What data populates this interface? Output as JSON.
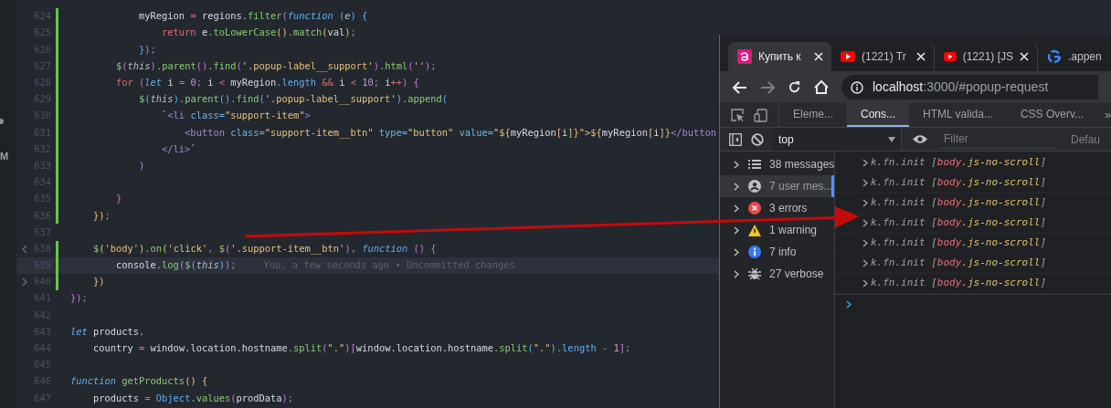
{
  "editor": {
    "side_letter": "M",
    "lines": [
      {
        "number": "624",
        "changed": true,
        "current": false,
        "tokens": [
          {
            "kind": "var",
            "text": "            myRegion "
          },
          {
            "kind": "op",
            "text": "="
          },
          {
            "kind": "var",
            "text": " regions"
          },
          {
            "kind": "fn",
            "text": ".filter"
          },
          {
            "kind": "b2",
            "text": "("
          },
          {
            "kind": "it",
            "text": "function "
          },
          {
            "kind": "b3",
            "text": "("
          },
          {
            "kind": "self",
            "text": "e"
          },
          {
            "kind": "b3",
            "text": ") {"
          }
        ]
      },
      {
        "number": "625",
        "changed": true,
        "current": false,
        "tokens": [
          {
            "kind": "kw",
            "text": "                return"
          },
          {
            "kind": "var",
            "text": " e"
          },
          {
            "kind": "fn",
            "text": ".toLowerCase"
          },
          {
            "kind": "b1",
            "text": "()"
          },
          {
            "kind": "fn",
            "text": ".match"
          },
          {
            "kind": "b1",
            "text": "("
          },
          {
            "kind": "var",
            "text": "val"
          },
          {
            "kind": "b1",
            "text": ")"
          },
          {
            "kind": "p",
            "text": ";"
          }
        ]
      },
      {
        "number": "626",
        "changed": true,
        "current": false,
        "tokens": [
          {
            "kind": "b3",
            "text": "            }"
          },
          {
            "kind": "b2",
            "text": ")"
          },
          {
            "kind": "p",
            "text": ";"
          }
        ]
      },
      {
        "number": "627",
        "changed": true,
        "current": false,
        "tokens": [
          {
            "kind": "fn",
            "text": "        $"
          },
          {
            "kind": "b2",
            "text": "("
          },
          {
            "kind": "self",
            "text": "this"
          },
          {
            "kind": "b2",
            "text": ")"
          },
          {
            "kind": "fn",
            "text": ".parent"
          },
          {
            "kind": "b2",
            "text": "()"
          },
          {
            "kind": "fn",
            "text": ".find"
          },
          {
            "kind": "b2",
            "text": "("
          },
          {
            "kind": "str",
            "text": "'.popup-label__support'"
          },
          {
            "kind": "b2",
            "text": ")"
          },
          {
            "kind": "fn",
            "text": ".html"
          },
          {
            "kind": "b2",
            "text": "("
          },
          {
            "kind": "str",
            "text": "''"
          },
          {
            "kind": "b2",
            "text": ")"
          },
          {
            "kind": "p",
            "text": ";"
          }
        ]
      },
      {
        "number": "628",
        "changed": true,
        "current": false,
        "tokens": [
          {
            "kind": "kw",
            "text": "        for "
          },
          {
            "kind": "b2",
            "text": "("
          },
          {
            "kind": "it",
            "text": "let"
          },
          {
            "kind": "var",
            "text": " i "
          },
          {
            "kind": "op",
            "text": "="
          },
          {
            "kind": "num",
            "text": " 0"
          },
          {
            "kind": "p",
            "text": ";"
          },
          {
            "kind": "var",
            "text": " i "
          },
          {
            "kind": "op",
            "text": "<"
          },
          {
            "kind": "var",
            "text": " myRegion"
          },
          {
            "kind": "prop",
            "text": ".length "
          },
          {
            "kind": "op",
            "text": "&&"
          },
          {
            "kind": "var",
            "text": " i "
          },
          {
            "kind": "op",
            "text": "<"
          },
          {
            "kind": "num",
            "text": " 10"
          },
          {
            "kind": "p",
            "text": ";"
          },
          {
            "kind": "var",
            "text": " i"
          },
          {
            "kind": "op",
            "text": "++"
          },
          {
            "kind": "b2",
            "text": ") {"
          }
        ]
      },
      {
        "number": "629",
        "changed": true,
        "current": false,
        "tokens": [
          {
            "kind": "fn",
            "text": "            $"
          },
          {
            "kind": "b3",
            "text": "("
          },
          {
            "kind": "self",
            "text": "this"
          },
          {
            "kind": "b3",
            "text": ")"
          },
          {
            "kind": "fn",
            "text": ".parent"
          },
          {
            "kind": "b3",
            "text": "()"
          },
          {
            "kind": "fn",
            "text": ".find"
          },
          {
            "kind": "b3",
            "text": "("
          },
          {
            "kind": "str",
            "text": "'.popup-label__support'"
          },
          {
            "kind": "b3",
            "text": ")"
          },
          {
            "kind": "fn",
            "text": ".append"
          },
          {
            "kind": "b3",
            "text": "("
          }
        ]
      },
      {
        "number": "630",
        "changed": true,
        "current": false,
        "tokens": [
          {
            "kind": "str",
            "text": "                `"
          },
          {
            "kind": "tag",
            "text": "<li"
          },
          {
            "kind": "attr",
            "text": " class="
          },
          {
            "kind": "str",
            "text": "\"support-item\""
          },
          {
            "kind": "tag",
            "text": ">"
          }
        ]
      },
      {
        "number": "631",
        "changed": true,
        "current": false,
        "tokens": [
          {
            "kind": "tag",
            "text": "                    <button"
          },
          {
            "kind": "attr",
            "text": " class="
          },
          {
            "kind": "str",
            "text": "\"support-item__btn\""
          },
          {
            "kind": "attr",
            "text": " type="
          },
          {
            "kind": "str",
            "text": "\"button\""
          },
          {
            "kind": "attr",
            "text": " value="
          },
          {
            "kind": "str",
            "text": "\"${"
          },
          {
            "kind": "var",
            "text": "myRegion"
          },
          {
            "kind": "b1",
            "text": "["
          },
          {
            "kind": "var",
            "text": "i"
          },
          {
            "kind": "b1",
            "text": "]"
          },
          {
            "kind": "str",
            "text": "}\">${"
          },
          {
            "kind": "var",
            "text": "myRegion"
          },
          {
            "kind": "b1",
            "text": "["
          },
          {
            "kind": "var",
            "text": "i"
          },
          {
            "kind": "b1",
            "text": "]"
          },
          {
            "kind": "str",
            "text": "}"
          },
          {
            "kind": "tag",
            "text": "</button"
          }
        ]
      },
      {
        "number": "632",
        "changed": true,
        "current": false,
        "tokens": [
          {
            "kind": "tag",
            "text": "                </li>"
          },
          {
            "kind": "str",
            "text": "`"
          }
        ]
      },
      {
        "number": "633",
        "changed": true,
        "current": false,
        "tokens": [
          {
            "kind": "b3",
            "text": "            )"
          }
        ]
      },
      {
        "number": "634",
        "changed": true,
        "current": false
      },
      {
        "number": "635",
        "changed": true,
        "current": false,
        "tokens": [
          {
            "kind": "b2",
            "text": "        }"
          }
        ]
      },
      {
        "number": "636",
        "changed": true,
        "current": false,
        "tokens": [
          {
            "kind": "b1",
            "text": "    })"
          },
          {
            "kind": "p",
            "text": ";"
          }
        ]
      },
      {
        "number": "637",
        "changed": false,
        "current": false
      },
      {
        "number": "638",
        "changed": true,
        "current": false,
        "kind": "fold_start",
        "tokens": [
          {
            "kind": "fn",
            "text": "    $"
          },
          {
            "kind": "b1",
            "text": "("
          },
          {
            "kind": "str",
            "text": "'body'"
          },
          {
            "kind": "b1",
            "text": ")"
          },
          {
            "kind": "fn",
            "text": ".on"
          },
          {
            "kind": "b1",
            "text": "("
          },
          {
            "kind": "str",
            "text": "'click'"
          },
          {
            "kind": "p",
            "text": ", "
          },
          {
            "kind": "fn",
            "text": "$"
          },
          {
            "kind": "b2",
            "text": "("
          },
          {
            "kind": "str",
            "text": "'.support-item__btn'"
          },
          {
            "kind": "b2",
            "text": ")"
          },
          {
            "kind": "p",
            "text": ", "
          },
          {
            "kind": "it",
            "text": "function "
          },
          {
            "kind": "b2",
            "text": "() {"
          }
        ]
      },
      {
        "number": "639",
        "changed": true,
        "current": true,
        "blame": "You, a few seconds ago • Uncommitted changes",
        "tokens": [
          {
            "kind": "var",
            "text": "        console"
          },
          {
            "kind": "fn",
            "text": ".log"
          },
          {
            "kind": "b2",
            "text": "("
          },
          {
            "kind": "fn",
            "text": "$"
          },
          {
            "kind": "b3",
            "text": "("
          },
          {
            "kind": "self",
            "text": "this"
          },
          {
            "kind": "b3",
            "text": ")"
          },
          {
            "kind": "b2",
            "text": ")"
          },
          {
            "kind": "p",
            "text": ";"
          }
        ]
      },
      {
        "number": "640",
        "changed": true,
        "current": false,
        "kind": "fold_end",
        "tokens": [
          {
            "kind": "b1",
            "text": "    })"
          }
        ]
      },
      {
        "number": "641",
        "changed": false,
        "current": false,
        "tokens": [
          {
            "kind": "b2",
            "text": "})"
          },
          {
            "kind": "p",
            "text": ";"
          }
        ]
      },
      {
        "number": "642",
        "changed": false,
        "current": false
      },
      {
        "number": "643",
        "changed": false,
        "current": false,
        "tokens": [
          {
            "kind": "it",
            "text": "let"
          },
          {
            "kind": "var",
            "text": " products"
          },
          {
            "kind": "p",
            "text": ","
          }
        ]
      },
      {
        "number": "644",
        "changed": false,
        "current": false,
        "tokens": [
          {
            "kind": "var",
            "text": "    country "
          },
          {
            "kind": "op",
            "text": "="
          },
          {
            "kind": "var",
            "text": " window.location.hostname"
          },
          {
            "kind": "fn",
            "text": ".split"
          },
          {
            "kind": "b2",
            "text": "("
          },
          {
            "kind": "str",
            "text": "\".\""
          },
          {
            "kind": "b2",
            "text": ")["
          },
          {
            "kind": "var",
            "text": "window.location.hostname"
          },
          {
            "kind": "fn",
            "text": ".split"
          },
          {
            "kind": "b3",
            "text": "("
          },
          {
            "kind": "str",
            "text": "\".\""
          },
          {
            "kind": "b3",
            "text": ")"
          },
          {
            "kind": "prop",
            "text": ".length "
          },
          {
            "kind": "op",
            "text": "-"
          },
          {
            "kind": "num",
            "text": " 1"
          },
          {
            "kind": "b2",
            "text": "]"
          },
          {
            "kind": "p",
            "text": ";"
          }
        ]
      },
      {
        "number": "645",
        "changed": false,
        "current": false
      },
      {
        "number": "646",
        "changed": false,
        "current": false,
        "tokens": [
          {
            "kind": "it",
            "text": "function"
          },
          {
            "kind": "fn",
            "text": " getProducts"
          },
          {
            "kind": "b1",
            "text": "() {"
          }
        ]
      },
      {
        "number": "647",
        "changed": false,
        "current": false,
        "tokens": [
          {
            "kind": "var",
            "text": "    products "
          },
          {
            "kind": "op",
            "text": "="
          },
          {
            "kind": "prop",
            "text": " Object"
          },
          {
            "kind": "fn",
            "text": ".values"
          },
          {
            "kind": "b2",
            "text": "("
          },
          {
            "kind": "var",
            "text": "prodData"
          },
          {
            "kind": "b2",
            "text": ")"
          },
          {
            "kind": "p",
            "text": ";"
          }
        ]
      }
    ]
  },
  "browser": {
    "tabs": [
      {
        "title": "Купить к",
        "kind": "shop",
        "selected": true
      },
      {
        "title": "(1221) Tr",
        "kind": "video",
        "selected": false
      },
      {
        "title": "(1221) [JS",
        "kind": "video",
        "selected": false
      },
      {
        "title": ".appen",
        "kind": "search",
        "selected": false
      }
    ],
    "url_host": "localhost",
    "url_rest": ":3000/#popup-request",
    "devtools": {
      "tabs": [
        {
          "label": "Eleme...",
          "selected": false
        },
        {
          "label": "Cons...",
          "selected": true
        },
        {
          "label": "HTML valida...",
          "selected": false
        },
        {
          "label": "CSS Overv...",
          "selected": false
        }
      ],
      "more": "»",
      "context": "top",
      "filter_placeholder": "Filter",
      "levels": "Defau",
      "sidebar": [
        {
          "label": "38 messages",
          "kind": "list",
          "selected": false
        },
        {
          "label": "7 user mes...",
          "kind": "user",
          "selected": true
        },
        {
          "label": "3 errors",
          "kind": "error",
          "selected": false
        },
        {
          "label": "1 warning",
          "kind": "warning",
          "selected": false
        },
        {
          "label": "7 info",
          "kind": "info",
          "selected": false
        },
        {
          "label": "27 verbose",
          "kind": "verbose",
          "selected": false
        }
      ],
      "messages": [
        {
          "name": "k.fn.init",
          "open": "[",
          "tag": "body",
          "cls": ".js-no-scroll",
          "close": "]"
        },
        {
          "name": "k.fn.init",
          "open": "[",
          "tag": "body",
          "cls": ".js-no-scroll",
          "close": "]"
        },
        {
          "name": "k.fn.init",
          "open": "[",
          "tag": "body",
          "cls": ".js-no-scroll",
          "close": "]"
        },
        {
          "name": "k.fn.init",
          "open": "[",
          "tag": "body",
          "cls": ".js-no-scroll",
          "close": "]"
        },
        {
          "name": "k.fn.init",
          "open": "[",
          "tag": "body",
          "cls": ".js-no-scroll",
          "close": "]"
        },
        {
          "name": "k.fn.init",
          "open": "[",
          "tag": "body",
          "cls": ".js-no-scroll",
          "close": "]"
        },
        {
          "name": "k.fn.init",
          "open": "[",
          "tag": "body",
          "cls": ".js-no-scroll",
          "close": "]"
        }
      ]
    }
  }
}
